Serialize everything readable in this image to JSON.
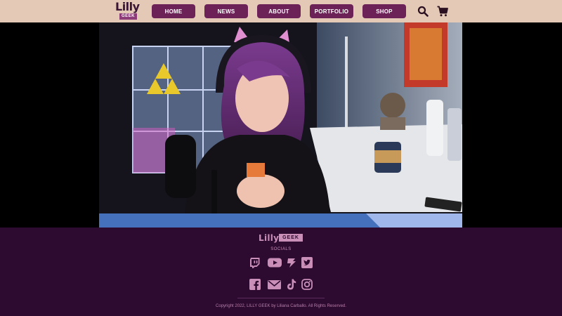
{
  "header": {
    "logo": {
      "main": "Lilly",
      "tag": "GEEK"
    },
    "nav": [
      {
        "label": "HOME"
      },
      {
        "label": "NEWS"
      },
      {
        "label": "ABOUT"
      },
      {
        "label": "PORTFOLIO"
      },
      {
        "label": "SHOP"
      }
    ],
    "icons": [
      "search-icon",
      "cart-icon"
    ]
  },
  "colors": {
    "header_bg": "#e5c9b7",
    "nav_button": "#6c2157",
    "footer_bg": "#2d0a30",
    "footer_accent": "#c98fb8"
  },
  "footer": {
    "logo": {
      "main": "Lilly",
      "tag": "GEEK"
    },
    "socials_label": "SOCIALS",
    "socials_row1": [
      "twitch-icon",
      "youtube-icon",
      "streamloots-icon",
      "twitter-icon"
    ],
    "socials_row2": [
      "facebook-icon",
      "mail-icon",
      "tiktok-icon",
      "instagram-icon"
    ],
    "copyright": "Copyright 2022, LILLY GEEK by Liliana Carballo. All Rights Reserved."
  }
}
